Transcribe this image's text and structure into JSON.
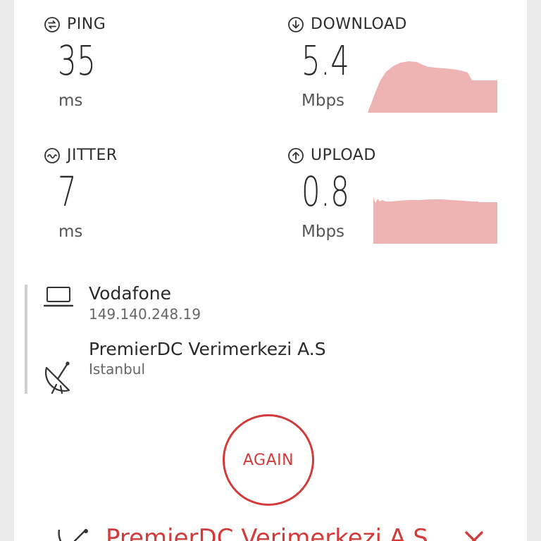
{
  "metrics": {
    "ping": {
      "label": "PING",
      "value": "35",
      "unit": "ms",
      "icon": "ping-icon"
    },
    "download": {
      "label": "DOWNLOAD",
      "value": "5.4",
      "unit": "Mbps",
      "icon": "download-arrow-icon"
    },
    "jitter": {
      "label": "JITTER",
      "value": "7",
      "unit": "ms",
      "icon": "jitter-icon"
    },
    "upload": {
      "label": "UPLOAD",
      "value": "0.8",
      "unit": "Mbps",
      "icon": "upload-arrow-icon"
    }
  },
  "connection": {
    "client": {
      "name": "Vodafone",
      "ip": "149.140.248.19",
      "icon": "laptop-icon"
    },
    "server": {
      "name": "PremierDC Verimerkezi A.S",
      "location": "Istanbul",
      "icon": "satellite-dish-icon"
    }
  },
  "actions": {
    "again_label": "AGAIN"
  },
  "bottom_bar": {
    "server_name": "PremierDC Verimerkezi A.S",
    "icon": "satellite-dish-icon"
  },
  "colors": {
    "accent": "#d33b3b",
    "graph_fill": "#eeb4b4"
  }
}
